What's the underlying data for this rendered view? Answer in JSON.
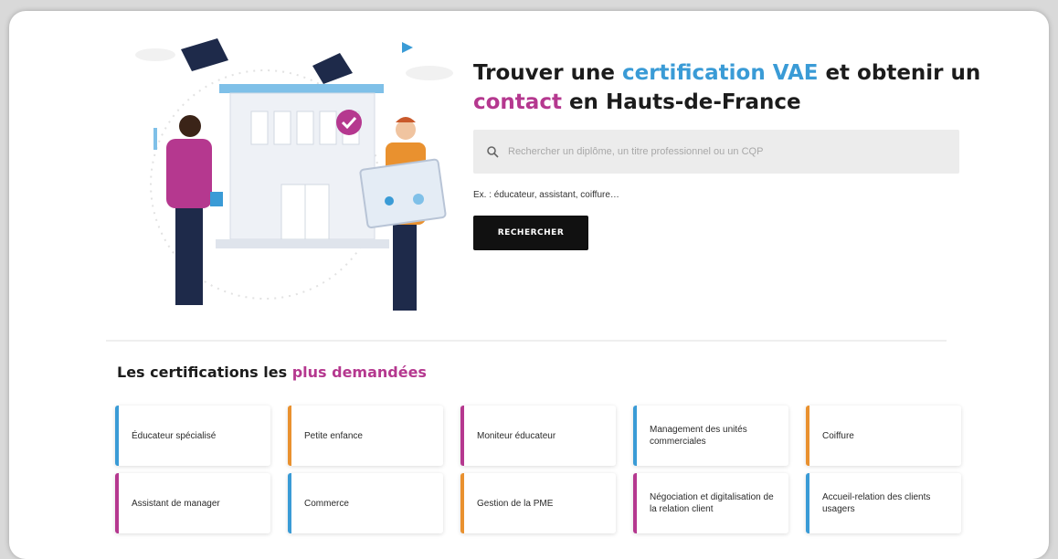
{
  "hero": {
    "title_part1": "Trouver une ",
    "title_hl1": "certification VAE",
    "title_part2": " et obtenir un ",
    "title_hl2": "contact",
    "title_part3": " en Hauts-de-France"
  },
  "search": {
    "placeholder": "Rechercher un diplôme, un titre professionnel ou un CQP",
    "hint": "Ex. : éducateur, assistant, coiffure…",
    "button_label": "RECHERCHER"
  },
  "popular": {
    "title_part1": "Les certifications les ",
    "title_hl": "plus demandées",
    "tiles": [
      {
        "label": "Éducateur spécialisé",
        "color": "#3a9bd6"
      },
      {
        "label": "Petite enfance",
        "color": "#e9912f"
      },
      {
        "label": "Moniteur éducateur",
        "color": "#b5388f"
      },
      {
        "label": "Management des unités commerciales",
        "color": "#3a9bd6"
      },
      {
        "label": "Coiffure",
        "color": "#e9912f"
      },
      {
        "label": "Assistant de manager",
        "color": "#b5388f"
      },
      {
        "label": "Commerce",
        "color": "#3a9bd6"
      },
      {
        "label": "Gestion de la PME",
        "color": "#e9912f"
      },
      {
        "label": "Négociation et digitalisation de la relation client",
        "color": "#b5388f"
      },
      {
        "label": "Accueil-relation des clients usagers",
        "color": "#3a9bd6"
      }
    ]
  },
  "colors": {
    "blue": "#3a9bd6",
    "pink": "#b5388f",
    "orange": "#e9912f",
    "dark": "#111111"
  }
}
